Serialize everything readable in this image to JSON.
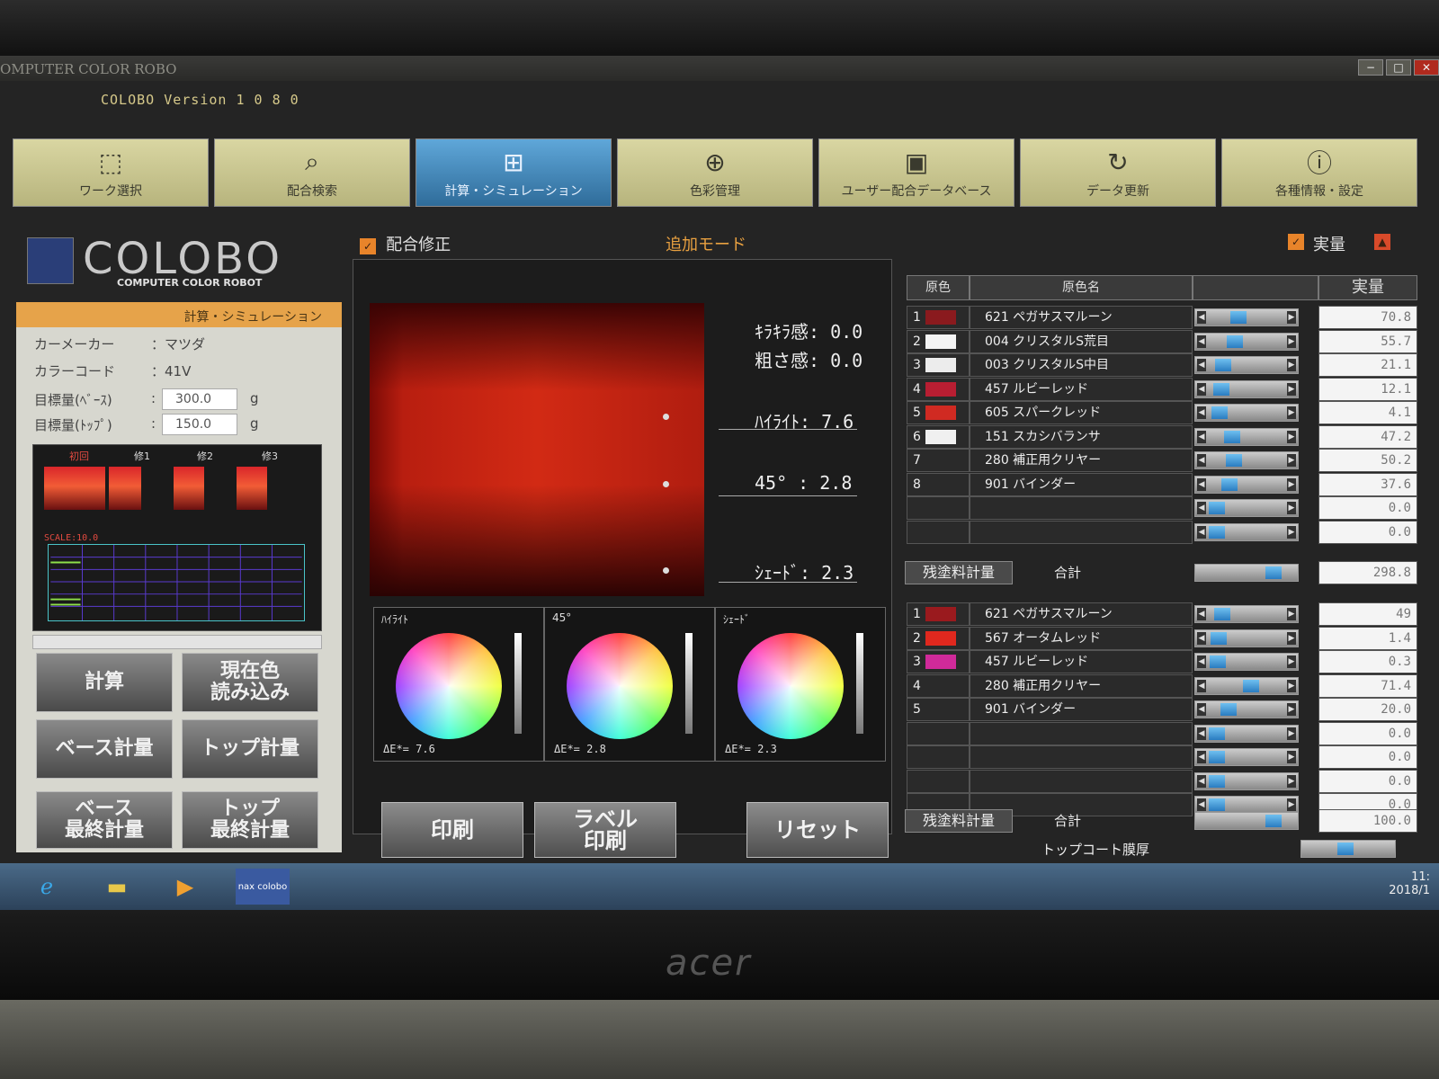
{
  "window": {
    "title": "OMPUTER COLOR ROBO",
    "version": "COLOBO Version 1 0 8 0"
  },
  "nav": [
    {
      "label": "ワーク選択",
      "icon": "box-icon"
    },
    {
      "label": "配合検索",
      "icon": "magnifier-icon"
    },
    {
      "label": "計算・シミュレーション",
      "icon": "calculator-icon"
    },
    {
      "label": "色彩管理",
      "icon": "crosshair-icon"
    },
    {
      "label": "ユーザー配合データベース",
      "icon": "car-icon"
    },
    {
      "label": "データ更新",
      "icon": "refresh-icon"
    },
    {
      "label": "各種情報・設定",
      "icon": "info-icon"
    }
  ],
  "logo": {
    "word": "COLOBO",
    "sub": "COMPUTER COLOR ROBOT"
  },
  "left": {
    "header": "計算・シミュレーション",
    "car_maker_label": "カーメーカー",
    "car_maker": "：マツダ",
    "color_code_label": "カラーコード",
    "color_code": "：41V",
    "target_base_label": "目標量(ﾍﾞｰｽ)",
    "target_base": "300.0",
    "target_top_label": "目標量(ﾄｯﾌﾟ)",
    "target_top": "150.0",
    "colon": ":",
    "unit": "g",
    "swatch_labels": [
      "初回",
      "修1",
      "修2",
      "修3"
    ],
    "scale": "SCALE:10.0"
  },
  "buttons": {
    "calc": "計算",
    "read_current": "現在色\n読み込み",
    "base_weigh": "ベース計量",
    "top_weigh": "トップ計量",
    "base_final": "ベース\n最終計量",
    "top_final": "トップ\n最終計量",
    "print": "印刷",
    "label_print": "ラベル\n印刷",
    "reset": "リセット"
  },
  "mode": {
    "fix_label": "配合修正",
    "add_mode": "追加モード",
    "actual_label": "実量"
  },
  "preview": {
    "sparkle": "ｷﾗｷﾗ感:  0.0",
    "coarse": "粗さ感:  0.0",
    "highlight": "ﾊｲﾗｲﾄ:  7.6",
    "deg45": "45°  :  2.8",
    "shade": "ｼｪｰﾄﾞ:  2.3"
  },
  "wheels": [
    {
      "title": "ﾊｲﾗｲﾄ",
      "de": "ΔE*=  7.6"
    },
    {
      "title": "45°",
      "de": "ΔE*=  2.8"
    },
    {
      "title": "ｼｪｰﾄﾞ",
      "de": "ΔE*=  2.3"
    }
  ],
  "table_head": {
    "col1": "原色",
    "col2": "原色名",
    "col3": "実量"
  },
  "base_rows": [
    {
      "no": "1",
      "name": "621  ペガサスマルーン",
      "value": "70.8",
      "chip": "#8a1a1e",
      "fill": 0.35
    },
    {
      "no": "2",
      "name": "004  クリスタルS荒目",
      "value": "55.7",
      "chip": "#f4f4f4",
      "fill": 0.3
    },
    {
      "no": "3",
      "name": "003  クリスタルS中目",
      "value": "21.1",
      "chip": "#ececec",
      "fill": 0.12
    },
    {
      "no": "4",
      "name": "457  ルビーレッド",
      "value": "12.1",
      "chip": "#b81e32",
      "fill": 0.08
    },
    {
      "no": "5",
      "name": "605  スパークレッド",
      "value": "4.1",
      "chip": "#d02a22",
      "fill": 0.05
    },
    {
      "no": "6",
      "name": "151  スカシバランサ",
      "value": "47.2",
      "chip": "#f0f0f0",
      "fill": 0.26
    },
    {
      "no": "7",
      "name": "280  補正用クリヤー",
      "value": "50.2",
      "chip": "",
      "fill": 0.28
    },
    {
      "no": "8",
      "name": "901  バインダー",
      "value": "37.6",
      "chip": "",
      "fill": 0.22
    },
    {
      "no": "",
      "name": "",
      "value": "0.0",
      "chip": "",
      "fill": 0.02
    },
    {
      "no": "",
      "name": "",
      "value": "0.0",
      "chip": "",
      "fill": 0.02
    }
  ],
  "base_total": {
    "remain": "残塗料計量",
    "label": "合計",
    "value": "298.8"
  },
  "top_rows": [
    {
      "no": "1",
      "name": "621  ペガサスマルーン",
      "value": "49",
      "chip": "#9a1a1e",
      "fill": 0.1
    },
    {
      "no": "2",
      "name": "567  オータムレッド",
      "value": "1.4",
      "chip": "#e0281e",
      "fill": 0.04
    },
    {
      "no": "3",
      "name": "457  ルビーレッド",
      "value": "0.3",
      "chip": "#d02a9a",
      "fill": 0.03
    },
    {
      "no": "4",
      "name": "280  補正用クリヤー",
      "value": "71.4",
      "chip": "",
      "fill": 0.55
    },
    {
      "no": "5",
      "name": "901  バインダー",
      "value": "20.0",
      "chip": "",
      "fill": 0.2
    },
    {
      "no": "",
      "name": "",
      "value": "0.0",
      "chip": "",
      "fill": 0.02
    },
    {
      "no": "",
      "name": "",
      "value": "0.0",
      "chip": "",
      "fill": 0.02
    },
    {
      "no": "",
      "name": "",
      "value": "0.0",
      "chip": "",
      "fill": 0.02
    },
    {
      "no": "",
      "name": "",
      "value": "0.0",
      "chip": "",
      "fill": 0.02
    }
  ],
  "top_total": {
    "remain": "残塗料計量",
    "label": "合計",
    "value": "100.0",
    "topcoat": "トップコート膜厚"
  },
  "tray": {
    "time": "11:",
    "date": "2018/1"
  },
  "taskbar_app": "nax colobo",
  "monitor_brand": "acer"
}
